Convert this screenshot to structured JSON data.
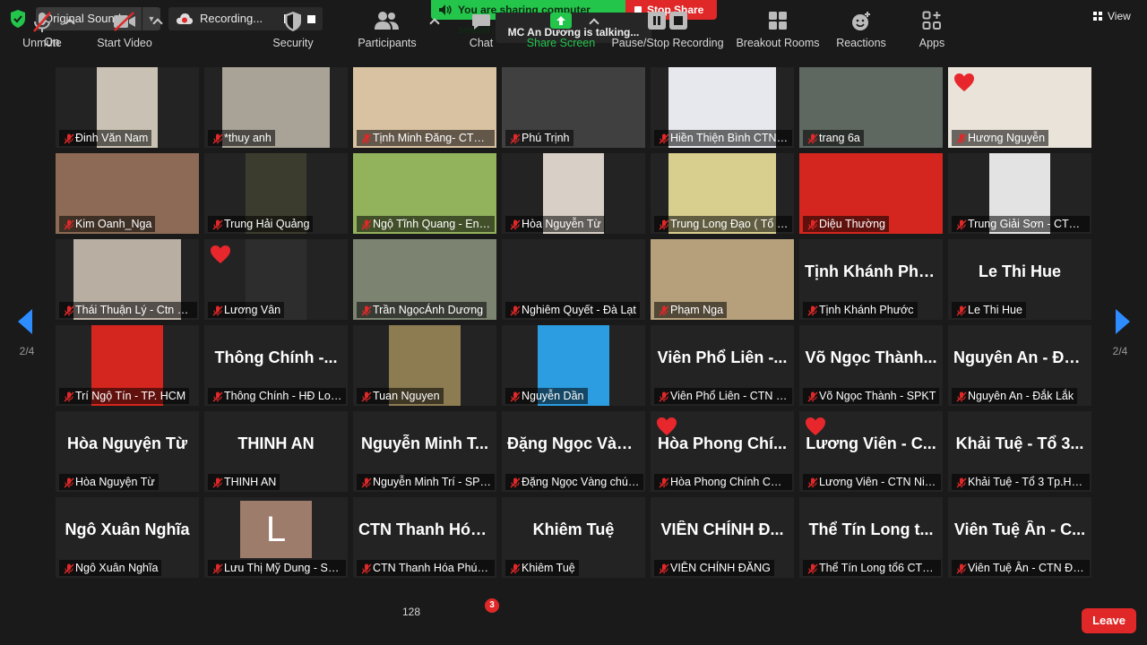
{
  "topbar": {
    "original_sound": "Original Sound: On",
    "recording": "Recording...",
    "sharing_banner": "You are sharing computer sound",
    "stop_share": "Stop Share",
    "talking": "MC An Dương is talking...",
    "view": "View"
  },
  "pagination": {
    "left": "2/4",
    "right": "2/4"
  },
  "participants": [
    {
      "name": "Đinh Văn Nam",
      "video": true,
      "bg": "#c9c1b3",
      "vx": 46,
      "vw": 68
    },
    {
      "name": "*thuy anh",
      "video": true,
      "bg": "#a9a397",
      "vx": 20,
      "vw": 120
    },
    {
      "name": "Tịnh Minh Đăng- CTN ...",
      "video": true,
      "bg": "#d9c2a2",
      "vx": 0,
      "vw": 160
    },
    {
      "name": "Phú Trịnh",
      "video": true,
      "bg": "#404040",
      "vx": 0,
      "vw": 160
    },
    {
      "name": "Hiền Thiện Bình  CTN ...",
      "video": true,
      "bg": "#e7e8ee",
      "vx": 20,
      "vw": 120
    },
    {
      "name": "trang 6a",
      "video": true,
      "bg": "#5e6760",
      "vx": 0,
      "vw": 160
    },
    {
      "name": "Hương Nguyễn",
      "video": true,
      "bg": "#e9e3d9",
      "vx": 0,
      "vw": 160,
      "heart": true
    },
    {
      "name": "Kim Oanh_Nga",
      "video": true,
      "bg": "#8c6a55",
      "vx": 0,
      "vw": 160
    },
    {
      "name": "Trung Hải Quảng",
      "video": true,
      "bg": "#3c3c2e",
      "vx": 46,
      "vw": 68
    },
    {
      "name": "Ngộ Tĩnh Quang - Eng...",
      "video": true,
      "bg": "#93b25c",
      "vx": 0,
      "vw": 160
    },
    {
      "name": "Hòa Nguyễn Từ",
      "video": true,
      "bg": "#d8cfc6",
      "vx": 46,
      "vw": 68
    },
    {
      "name": "Trung Long Đạo ( Tổ L...",
      "video": true,
      "bg": "#d8cf8e",
      "vx": 20,
      "vw": 120
    },
    {
      "name": "Diệu Thường",
      "video": true,
      "bg": "#d4261e",
      "vx": 0,
      "vw": 160
    },
    {
      "name": "Trung Giải Sơn - CTN ...",
      "video": true,
      "bg": "#e3e3e3",
      "vx": 46,
      "vw": 68
    },
    {
      "name": "Thái Thuận Lý - Ctn Đà...",
      "video": true,
      "bg": "#b8aea2",
      "vx": 20,
      "vw": 120
    },
    {
      "name": "Lương Vân",
      "video": true,
      "bg": "#2d2d2d",
      "vx": 46,
      "vw": 68,
      "heart": true
    },
    {
      "name": "Trần NgọcÁnh Dương",
      "video": true,
      "bg": "#7c8471",
      "vx": 0,
      "vw": 160
    },
    {
      "name": "Nghiêm Quyết - Đà Lạt",
      "video": false
    },
    {
      "name": "Phạm Nga",
      "video": true,
      "bg": "#b6a07b",
      "vx": 0,
      "vw": 160
    },
    {
      "name": "Tịnh Khánh Phước",
      "video": false,
      "big": "Tịnh Khánh Phư..."
    },
    {
      "name": "Le Thi Hue",
      "video": false,
      "big": "Le Thi Hue"
    },
    {
      "name": "Trí Ngộ Tín - TP. HCM",
      "video": true,
      "bg": "#d4261e",
      "vx": 40,
      "vw": 80
    },
    {
      "name": "Thông Chính - HĐ Lon...",
      "video": false,
      "big": "Thông Chính -..."
    },
    {
      "name": "Tuan Nguyen",
      "video": true,
      "bg": "#8d7b52",
      "vx": 40,
      "vw": 80
    },
    {
      "name": "Nguyễn Dần",
      "video": true,
      "bg": "#2b9de0",
      "vx": 40,
      "vw": 80
    },
    {
      "name": "Viên Phổ Liên - CTN H...",
      "video": false,
      "big": "Viên Phổ Liên -..."
    },
    {
      "name": "Võ Ngọc Thành - SPKT",
      "video": false,
      "big": "Võ Ngọc Thành..."
    },
    {
      "name": "Nguyên An - Đắk Lắk",
      "video": false,
      "big": "Nguyên An - Đắ..."
    },
    {
      "name": "Hòa Nguyện Từ",
      "video": false,
      "big": "Hòa Nguyện Từ"
    },
    {
      "name": "THINH AN",
      "video": false,
      "big": "THINH AN"
    },
    {
      "name": "Nguyễn Minh Trí - SPKT",
      "video": false,
      "big": "Nguyễn Minh T..."
    },
    {
      "name": "Đặng Ngọc Vàng chún...",
      "video": false,
      "big": "Đặng Ngọc Vàn..."
    },
    {
      "name": "Hòa Phong Chính CTN...",
      "video": false,
      "big": "Hòa Phong Chí...",
      "heart": true
    },
    {
      "name": "Lương Viên - CTN Nin...",
      "video": false,
      "big": "Lương Viên - C...",
      "heart": true
    },
    {
      "name": "Khải Tuệ - Tổ 3 Tp.HCM",
      "video": false,
      "big": "Khải Tuệ - Tổ 3..."
    },
    {
      "name": "Ngô Xuân Nghĩa",
      "video": false,
      "big": "Ngô Xuân Nghĩa"
    },
    {
      "name": "Lưu Thị Mỹ Dung - SP...",
      "video": false,
      "avatar": "L"
    },
    {
      "name": "CTN Thanh Hóa Phúc ...",
      "video": false,
      "big": "CTN Thanh Hóa..."
    },
    {
      "name": "Khiêm Tuệ",
      "video": false,
      "big": "Khiêm Tuệ"
    },
    {
      "name": "VIÊN CHÍNH ĐĂNG",
      "video": false,
      "big": "VIÊN CHÍNH Đ..."
    },
    {
      "name": "Thể Tín Long  tổ6 CTN...",
      "video": false,
      "big": "Thể Tín Long  t..."
    },
    {
      "name": "Viên Tuệ Ân - CTN Đài...",
      "video": false,
      "big": "Viên Tuệ Ân - C..."
    }
  ],
  "toolbar": {
    "unmute": "Unmute",
    "start_video": "Start Video",
    "security": "Security",
    "participants": "Participants",
    "participants_count": "128",
    "chat": "Chat",
    "chat_badge": "3",
    "share_screen": "Share Screen",
    "pause_stop_recording": "Pause/Stop Recording",
    "breakout_rooms": "Breakout Rooms",
    "reactions": "Reactions",
    "apps": "Apps",
    "leave": "Leave"
  },
  "colors": {
    "accent": "#2d8cff",
    "share_green": "#23c54b",
    "leave_red": "#e02828"
  }
}
